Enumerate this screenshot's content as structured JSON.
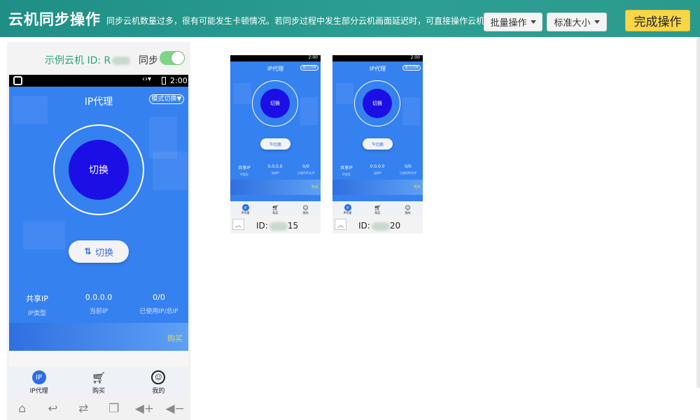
{
  "header": {
    "title": "云机同步操作",
    "notice": "同步云机数量过多，很有可能发生卡顿情况。若同步过程中发生部分云机画面延迟时，可直接操作云机",
    "batch_label": "批量操作",
    "size_label": "标准大小",
    "done_label": "完成操作"
  },
  "main_phone": {
    "name_prefix": "示例云机 ID: R",
    "sync_label": "同步",
    "sync_on": true,
    "time": "2:00",
    "app_title": "IP代理",
    "mode_switch": "模式切换",
    "core_label": "切换",
    "pill_label": "切换",
    "stats": [
      {
        "value": "共享IP",
        "label": "IP类型"
      },
      {
        "value": "0.0.0.0",
        "label": "当前IP"
      },
      {
        "value": "0/0",
        "label": "已使用IP/总IP"
      }
    ],
    "buy": "购买",
    "tabs": [
      "IP代理",
      "购买",
      "我的"
    ],
    "nav_icons": [
      "home-icon",
      "back-icon",
      "switch-icon",
      "copy-icon",
      "volume-down-icon",
      "volume-mute-icon"
    ]
  },
  "small_phones": [
    {
      "time": "2:00",
      "app_title": "IP代理",
      "mode_switch": "模式切换",
      "core_label": "切换",
      "pill_label": "切换",
      "stats": [
        {
          "value": "共享IP",
          "label": "IP类型"
        },
        {
          "value": "0.0.0.0",
          "label": "当前IP"
        },
        {
          "value": "0/0",
          "label": "已使用IP/总IP"
        }
      ],
      "buy": "购买",
      "tabs": [
        "IP代理",
        "购买",
        "我的"
      ],
      "id_prefix": "ID:",
      "id_suffix": "15"
    },
    {
      "time": "2:00",
      "app_title": "IP代理",
      "mode_switch": "模式切换",
      "core_label": "切换",
      "pill_label": "切换",
      "stats": [
        {
          "value": "共享IP",
          "label": "IP类型"
        },
        {
          "value": "0.0.0.0",
          "label": "当前IP"
        },
        {
          "value": "0/0",
          "label": "已使用IP/总IP"
        }
      ],
      "buy": "购买",
      "tabs": [
        "IP代理",
        "购买",
        "我的"
      ],
      "id_prefix": "ID:",
      "id_suffix": "20"
    }
  ]
}
